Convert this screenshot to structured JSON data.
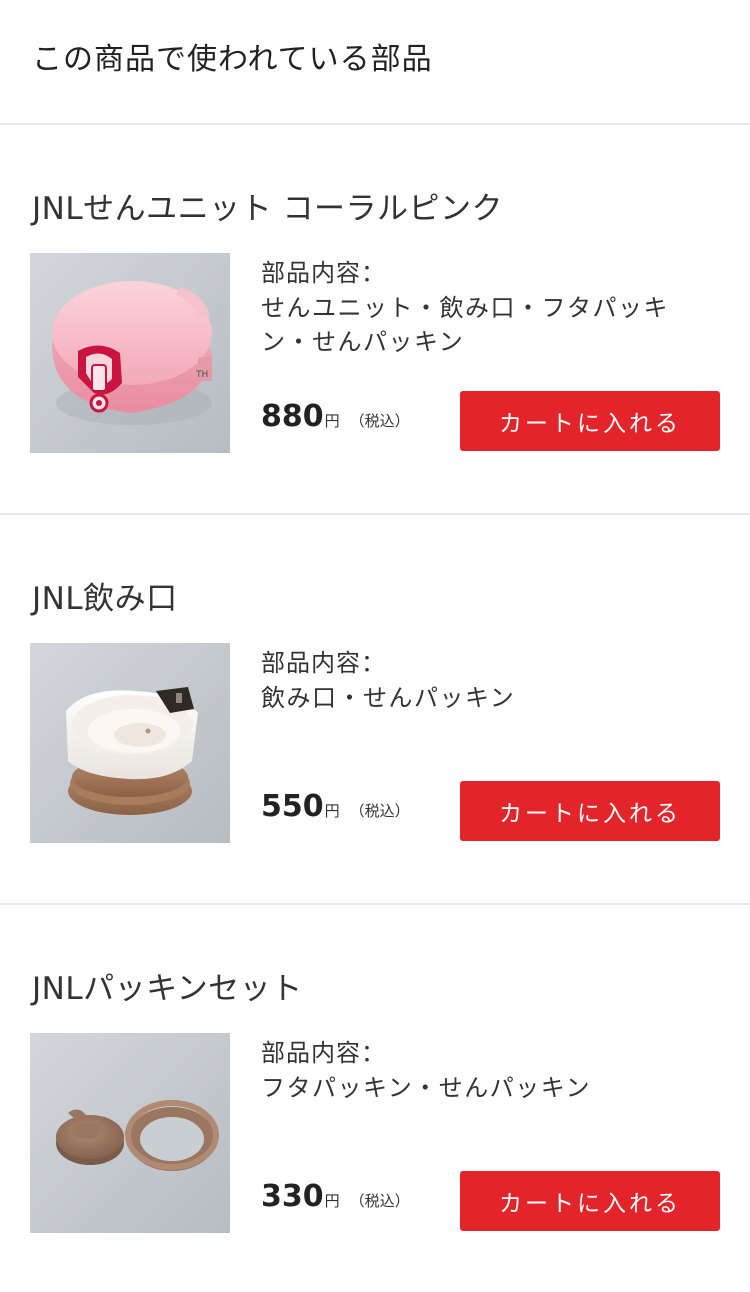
{
  "page": {
    "title": "この商品で使われている部品"
  },
  "parts": [
    {
      "name": "JNLせんユニット コーラルピンク",
      "contents_label": "部品内容：",
      "contents": "せんユニット・飲み口・フタパッキン・せんパッキン",
      "price": "880",
      "price_unit": "円",
      "tax_note": "（税込）",
      "button_label": "カートに入れる",
      "image_icon": "pink-stopper-unit-photo"
    },
    {
      "name": "JNL飲み口",
      "contents_label": "部品内容：",
      "contents": "飲み口・せんパッキン",
      "price": "550",
      "price_unit": "円",
      "tax_note": "（税込）",
      "button_label": "カートに入れる",
      "image_icon": "mouthpiece-photo"
    },
    {
      "name": "JNLパッキンセット",
      "contents_label": "部品内容：",
      "contents": "フタパッキン・せんパッキン",
      "price": "330",
      "price_unit": "円",
      "tax_note": "（税込）",
      "button_label": "カートに入れる",
      "image_icon": "gasket-set-photo"
    }
  ],
  "colors": {
    "accent": "#e4242b",
    "divider": "#e8e8e8",
    "text": "#333333"
  }
}
